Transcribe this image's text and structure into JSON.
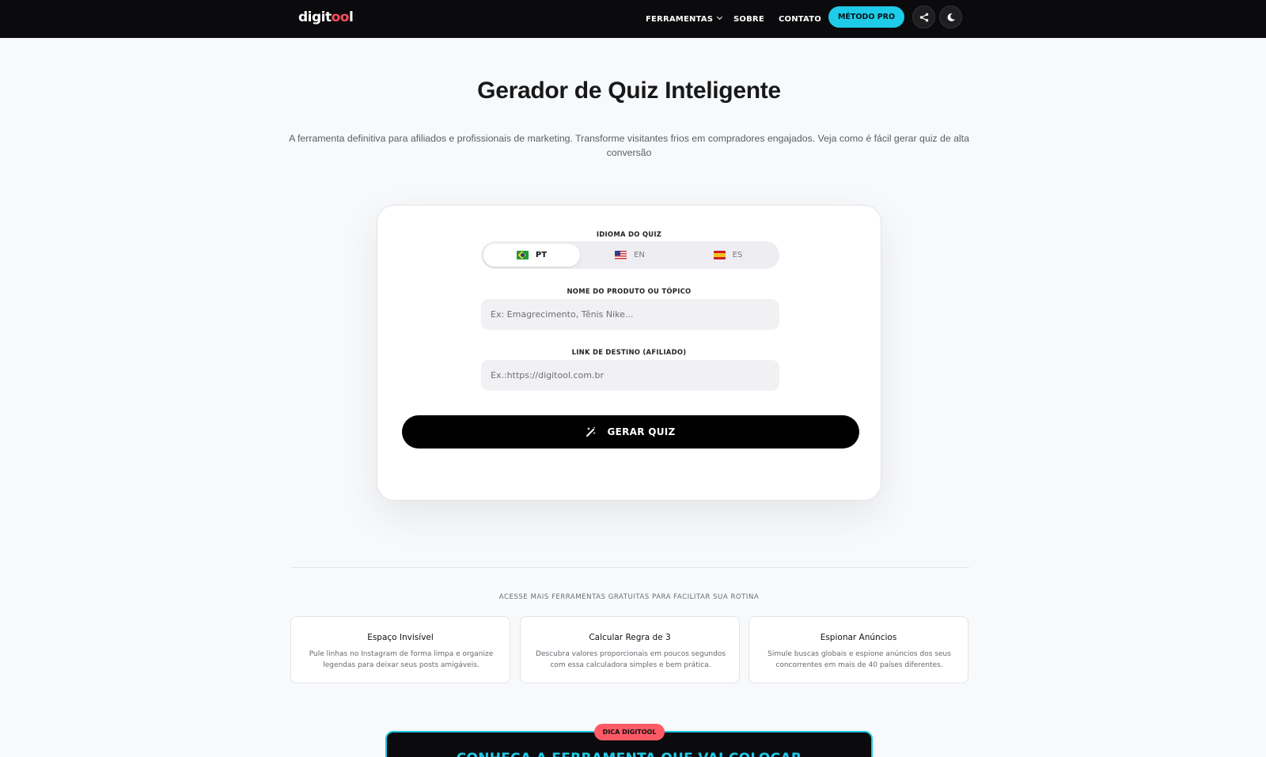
{
  "header": {
    "logo_text": "digitool",
    "nav": {
      "tools_label": "FERRAMENTAS",
      "about_label": "SOBRE",
      "contact_label": "CONTATO"
    },
    "pro_button_label": "MÉTODO PRO",
    "icons": {
      "share": "share-icon",
      "theme": "moon-icon"
    }
  },
  "hero": {
    "title": "Gerador de Quiz Inteligente",
    "subtitle": "A ferramenta definitiva para afiliados e profissionais de marketing. Transforme visitantes frios em compradores engajados. Veja como é fácil gerar quiz de alta conversão"
  },
  "form": {
    "language_label": "IDIOMA DO QUIZ",
    "languages": [
      {
        "code": "PT",
        "flag": "flag-brazil",
        "selected": true
      },
      {
        "code": "EN",
        "flag": "flag-usa",
        "selected": false
      },
      {
        "code": "ES",
        "flag": "flag-spain",
        "selected": false
      }
    ],
    "product_label": "NOME DO PRODUTO OU TÓPICO",
    "product_placeholder": "Ex: Emagrecimento, Tênis Nike...",
    "product_value": "",
    "link_label": "LINK DE DESTINO (AFILIADO)",
    "link_placeholder": "Ex.:https://digitool.com.br",
    "link_value": "",
    "submit_label": "GERAR QUIZ",
    "submit_icon": "magic-wand-icon"
  },
  "tools": {
    "heading": "ACESSE MAIS FERRAMENTAS GRATUITAS PARA FACILITAR SUA ROTINA",
    "items": [
      {
        "title": "Espaço Invisível",
        "desc_line1": "Pule linhas no Instagram de forma limpa e organize",
        "desc_line2": "legendas para deixar seus posts amigáveis."
      },
      {
        "title": "Calcular Regra de 3",
        "desc_line1": "Descubra valores proporcionais em poucos segundos",
        "desc_line2": "com essa calculadora simples e bem prática."
      },
      {
        "title": "Espionar Anúncios",
        "desc_line1": "Simule buscas globais e espione anúncios dos seus",
        "desc_line2": "concorrentes em mais de 40 países diferentes."
      }
    ]
  },
  "promo": {
    "badge": "DICA DIGITOOL",
    "title": "CONHEÇA A FERRAMENTA QUE VAI COLOCAR"
  },
  "colors": {
    "accent": "#1ecbe8",
    "brand_red": "#ff4d5a",
    "header_bg": "#0b0b0d",
    "button_bg": "#000000"
  }
}
